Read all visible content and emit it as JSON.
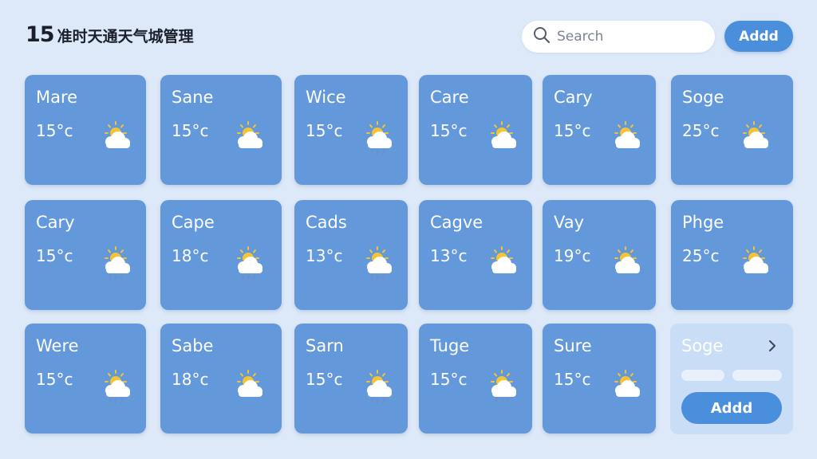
{
  "header": {
    "title_number": "15",
    "title_text": "准时天通天气城管理"
  },
  "search": {
    "placeholder": "Search"
  },
  "toolbar": {
    "add_label": "Addd"
  },
  "colors": {
    "background": "#dde9f8",
    "card": "#6399db",
    "accent": "#4a8fdc",
    "sun": "#f4c433",
    "cloud": "#ffffff",
    "rain": "#6e8fc4"
  },
  "cities": [
    {
      "name": "Mare",
      "temp": "15°c",
      "icon": "sun-cloud-icon"
    },
    {
      "name": "Sane",
      "temp": "15°c",
      "icon": "sun-cloud-icon"
    },
    {
      "name": "Wice",
      "temp": "15°c",
      "icon": "sun-cloud-rain-icon"
    },
    {
      "name": "Care",
      "temp": "15°c",
      "icon": "sun-cloud-icon"
    },
    {
      "name": "Cary",
      "temp": "15°c",
      "icon": "sun-cloud-icon"
    },
    {
      "name": "Soge",
      "temp": "25°c",
      "icon": "sun-cloud-icon"
    },
    {
      "name": "Cary",
      "temp": "15°c",
      "icon": "sun-cloud-rain-icon"
    },
    {
      "name": "Cape",
      "temp": "18°c",
      "icon": "sun-cloud-rain-icon"
    },
    {
      "name": "Cads",
      "temp": "13°c",
      "icon": "sun-cloud-rain-icon"
    },
    {
      "name": "Cagve",
      "temp": "13°c",
      "icon": "sun-cloud-icon"
    },
    {
      "name": "Vay",
      "temp": "19°c",
      "icon": "sun-cloud-icon"
    },
    {
      "name": "Phge",
      "temp": "25°c",
      "icon": "sun-cloud-icon"
    },
    {
      "name": "Were",
      "temp": "15°c",
      "icon": "sun-cloud-rain-icon"
    },
    {
      "name": "Sabe",
      "temp": "18°c",
      "icon": "sun-cloud-icon"
    },
    {
      "name": "Sarn",
      "temp": "15°c",
      "icon": "sun-cloud-rain-icon"
    },
    {
      "name": "Tuge",
      "temp": "15°c",
      "icon": "sun-cloud-rain-icon"
    },
    {
      "name": "Sure",
      "temp": "15°c",
      "icon": "sun-cloud-icon"
    }
  ],
  "add_card": {
    "name": "Soge",
    "add_label": "Addd",
    "icon": "chevron-right-icon"
  }
}
